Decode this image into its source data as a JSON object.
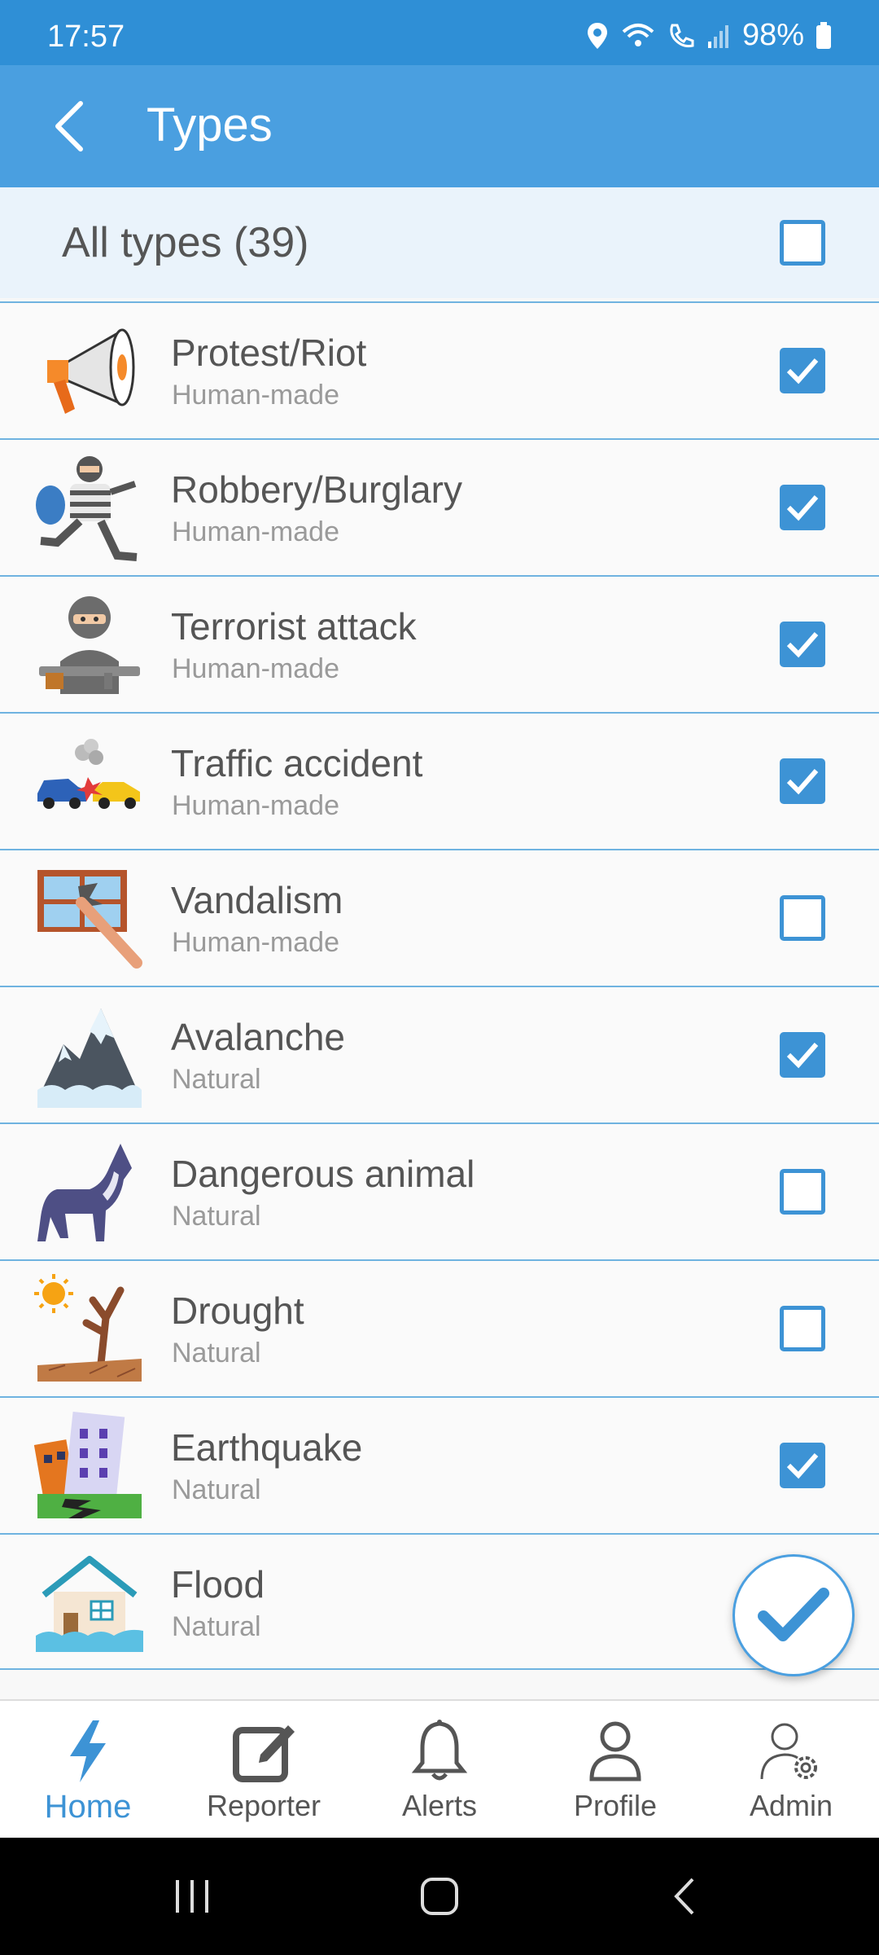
{
  "status_bar": {
    "time": "17:57",
    "battery": "98%"
  },
  "app_bar": {
    "title": "Types"
  },
  "all_types": {
    "label": "All types (39)",
    "checked": false
  },
  "types": [
    {
      "name": "Protest/Riot",
      "category": "Human-made",
      "checked": true,
      "icon": "megaphone-icon"
    },
    {
      "name": "Robbery/Burglary",
      "category": "Human-made",
      "checked": true,
      "icon": "robber-icon"
    },
    {
      "name": "Terrorist attack",
      "category": "Human-made",
      "checked": true,
      "icon": "terrorist-icon"
    },
    {
      "name": "Traffic accident",
      "category": "Human-made",
      "checked": true,
      "icon": "car-crash-icon"
    },
    {
      "name": "Vandalism",
      "category": "Human-made",
      "checked": false,
      "icon": "broken-window-icon"
    },
    {
      "name": "Avalanche",
      "category": "Natural",
      "checked": true,
      "icon": "mountain-snow-icon"
    },
    {
      "name": "Dangerous animal",
      "category": "Natural",
      "checked": false,
      "icon": "wolf-icon"
    },
    {
      "name": "Drought",
      "category": "Natural",
      "checked": false,
      "icon": "dead-tree-sun-icon"
    },
    {
      "name": "Earthquake",
      "category": "Natural",
      "checked": true,
      "icon": "earthquake-building-icon"
    },
    {
      "name": "Flood",
      "category": "Natural",
      "checked": false,
      "icon": "flooded-house-icon"
    }
  ],
  "bottom_nav": [
    {
      "label": "Home",
      "icon": "lightning-icon",
      "active": true
    },
    {
      "label": "Reporter",
      "icon": "edit-icon",
      "active": false
    },
    {
      "label": "Alerts",
      "icon": "bell-icon",
      "active": false
    },
    {
      "label": "Profile",
      "icon": "person-icon",
      "active": false
    },
    {
      "label": "Admin",
      "icon": "admin-gear-icon",
      "active": false
    }
  ],
  "colors": {
    "status_bar": "#2f8fd6",
    "app_bar": "#4a9fe0",
    "accent": "#3d93d5",
    "divider": "#6fb3e0"
  }
}
